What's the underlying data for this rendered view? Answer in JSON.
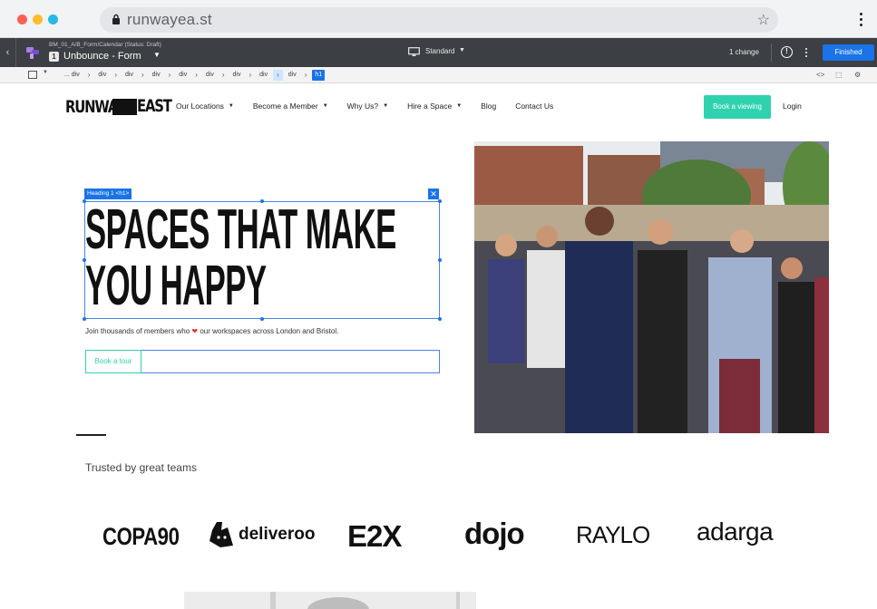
{
  "browser": {
    "url": "runwayea.st"
  },
  "editor": {
    "doc_path": "BM_01_A/B_Form/Calendar (Status: Draft)",
    "doc_number": "1",
    "doc_title": "Unbounce - Form",
    "device_label": "Standard",
    "changes": "1 change",
    "finished_label": "Finished"
  },
  "breadcrumbs": {
    "items": [
      "... div",
      "div",
      "div",
      "div",
      "div",
      "div",
      "div",
      "div",
      "div",
      "h1"
    ]
  },
  "site": {
    "logo_left": "RUNWAY",
    "logo_right": "EAST",
    "nav": [
      "Our Locations",
      "Become a Member",
      "Why Us?",
      "Hire a Space",
      "Blog",
      "Contact Us"
    ],
    "book_viewing": "Book a viewing",
    "login": "Login",
    "selection_label": "Heading 1 <h1>",
    "headline": "SPACES THAT MAKE YOU HAPPY",
    "subline_before": "Join thousands of members who",
    "subline_after": "our workspaces across London and Bristol.",
    "book_tour": "Book a tour",
    "trusted": "Trusted by great teams",
    "brands": [
      "COPA90",
      "deliveroo",
      "E2X",
      "dojo",
      "RAYLO",
      "adarga"
    ]
  },
  "colors": {
    "accent_teal": "#2fd2ae",
    "editor_blue": "#1a73e8",
    "editor_bar": "#3c3f43"
  }
}
